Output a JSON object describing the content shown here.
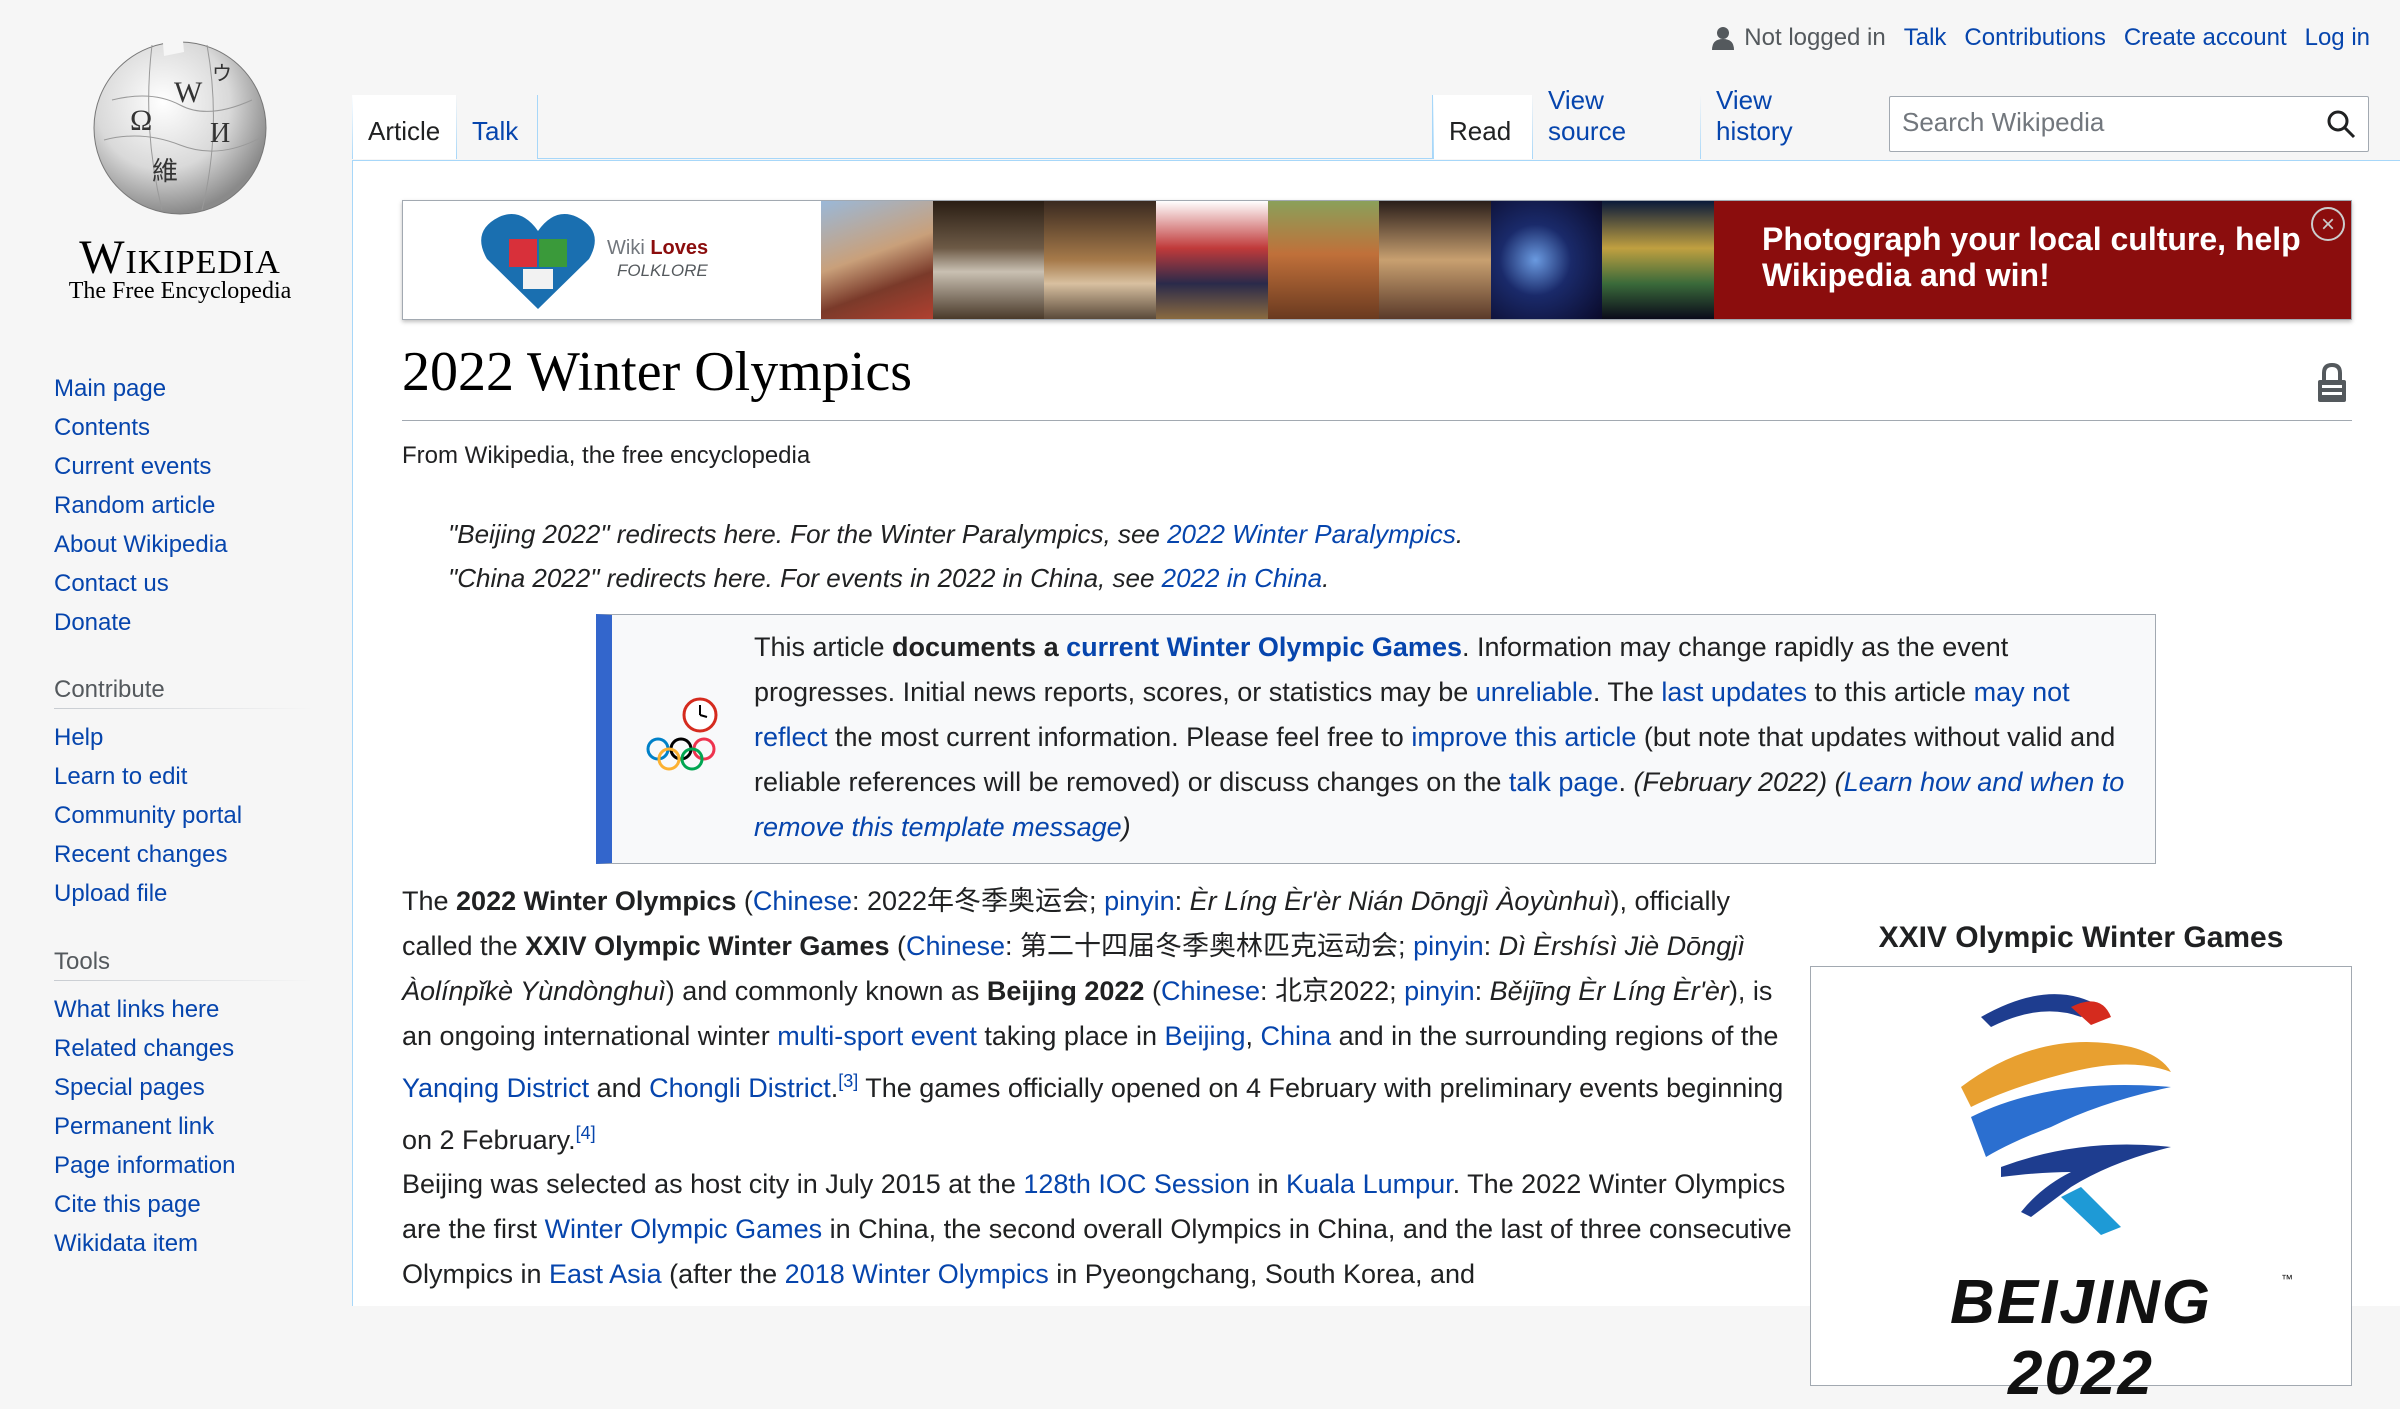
{
  "logo": {
    "wordmark": "Wikipedia",
    "tagline": "The Free Encyclopedia"
  },
  "personal": {
    "not_logged_in": "Not logged in",
    "links": [
      "Talk",
      "Contributions",
      "Create account",
      "Log in"
    ]
  },
  "tabs": {
    "article": "Article",
    "talk": "Talk",
    "read": "Read",
    "view_source": "View source",
    "view_history": "View history"
  },
  "search": {
    "placeholder": "Search Wikipedia"
  },
  "sidebar": {
    "nav": [
      "Main page",
      "Contents",
      "Current events",
      "Random article",
      "About Wikipedia",
      "Contact us",
      "Donate"
    ],
    "contribute": {
      "heading": "Contribute",
      "items": [
        "Help",
        "Learn to edit",
        "Community portal",
        "Recent changes",
        "Upload file"
      ]
    },
    "tools": {
      "heading": "Tools",
      "items": [
        "What links here",
        "Related changes",
        "Special pages",
        "Permanent link",
        "Page information",
        "Cite this page",
        "Wikidata item"
      ]
    }
  },
  "banner": {
    "logo_line1": "Wiki",
    "logo_line1b": "Loves",
    "logo_line2": "FOLKLORE",
    "cta_line1": "Photograph your local culture, help",
    "cta_line2": "Wikipedia and win!",
    "close": "×"
  },
  "article": {
    "title": "2022 Winter Olympics",
    "from": "From Wikipedia, the free encyclopedia",
    "hatnote1": {
      "text": "\"Beijing 2022\" redirects here. For the Winter Paralympics, see ",
      "link": "2022 Winter Paralympics",
      "end": "."
    },
    "hatnote2": {
      "text": "\"China 2022\" redirects here. For events in 2022 in China, see ",
      "link": "2022 in China",
      "end": "."
    },
    "ambox": {
      "t1": "This article ",
      "b1": "documents a ",
      "l1": "current Winter Olympic Games",
      "t2": ". Information may change rapidly as the event progresses. Initial news reports, scores, or statistics may be ",
      "l2": "unreliable",
      "t3": ". The ",
      "l3": "last updates",
      "t4": " to this article ",
      "l4": "may not reflect",
      "t5": " the most current information. Please feel free to ",
      "l5": "improve this article",
      "t6": " (but note that updates without valid and reliable references will be removed) or discuss changes on the ",
      "l6": "talk page",
      "t7": ". ",
      "i1": "(February 2022)",
      "t8": " ",
      "i2a": "(",
      "l7": "Learn how and when to remove this template message",
      "i2b": ")"
    },
    "p1": {
      "a": "The ",
      "b1": "2022 Winter Olympics",
      "c": " (",
      "l1": "Chinese",
      "d": ": 2022年冬季奥运会; ",
      "l2": "pinyin",
      "e": ": ",
      "i1": "Èr Líng Èr'èr Nián Dōngjì Àoyùnhuì",
      "f": "), officially called the ",
      "b2": "XXIV Olympic Winter Games",
      "g": " (",
      "l3": "Chinese",
      "h": ": 第二十四届冬季奥林匹克运动会; ",
      "l4": "pinyin",
      "i": ": ",
      "i2": "Dì Èrshísì Jiè Dōngjì Àolínpǐkè Yùndònghuì",
      "j": ") and commonly known as ",
      "b3": "Beijing 2022",
      "k": " (",
      "l5": "Chinese",
      "m": ": 北京2022; ",
      "l6": "pinyin",
      "n": ": ",
      "i3": "Běijīng Èr Líng Èr'èr",
      "o": "), is an ongoing international winter ",
      "l7": "multi-sport event",
      "p": " taking place in ",
      "l8": "Beijing",
      "q": ", ",
      "l9": "China",
      "r": " and in the surrounding regions of the ",
      "l10": "Yanqing District",
      "s": " and ",
      "l11": "Chongli District",
      "t": ".",
      "ref1": "[3]",
      "u": " The games officially opened on 4 February with preliminary events beginning on 2 February.",
      "ref2": "[4]"
    },
    "p2": {
      "a": "Beijing was selected as host city in July 2015 at the ",
      "l1": "128th IOC Session",
      "b": " in ",
      "l2": "Kuala Lumpur",
      "c": ". The 2022 Winter Olympics are the first ",
      "l3": "Winter Olympic Games",
      "d": " in China, the second overall Olympics in China, and the last of three consecutive Olympics in ",
      "l4": "East Asia",
      "e": " (after the ",
      "l5": "2018 Winter Olympics",
      "f": " in Pyeongchang, South Korea, and"
    },
    "infobox": {
      "caption": "XXIV Olympic Winter Games",
      "emblem_text": "BEIJING 2022",
      "tm": "™"
    }
  },
  "colors": {
    "link": "#0645ad",
    "banner_red": "#8b0d0d",
    "ambox_bar": "#3366cc",
    "content_border": "#a7d7f9"
  }
}
